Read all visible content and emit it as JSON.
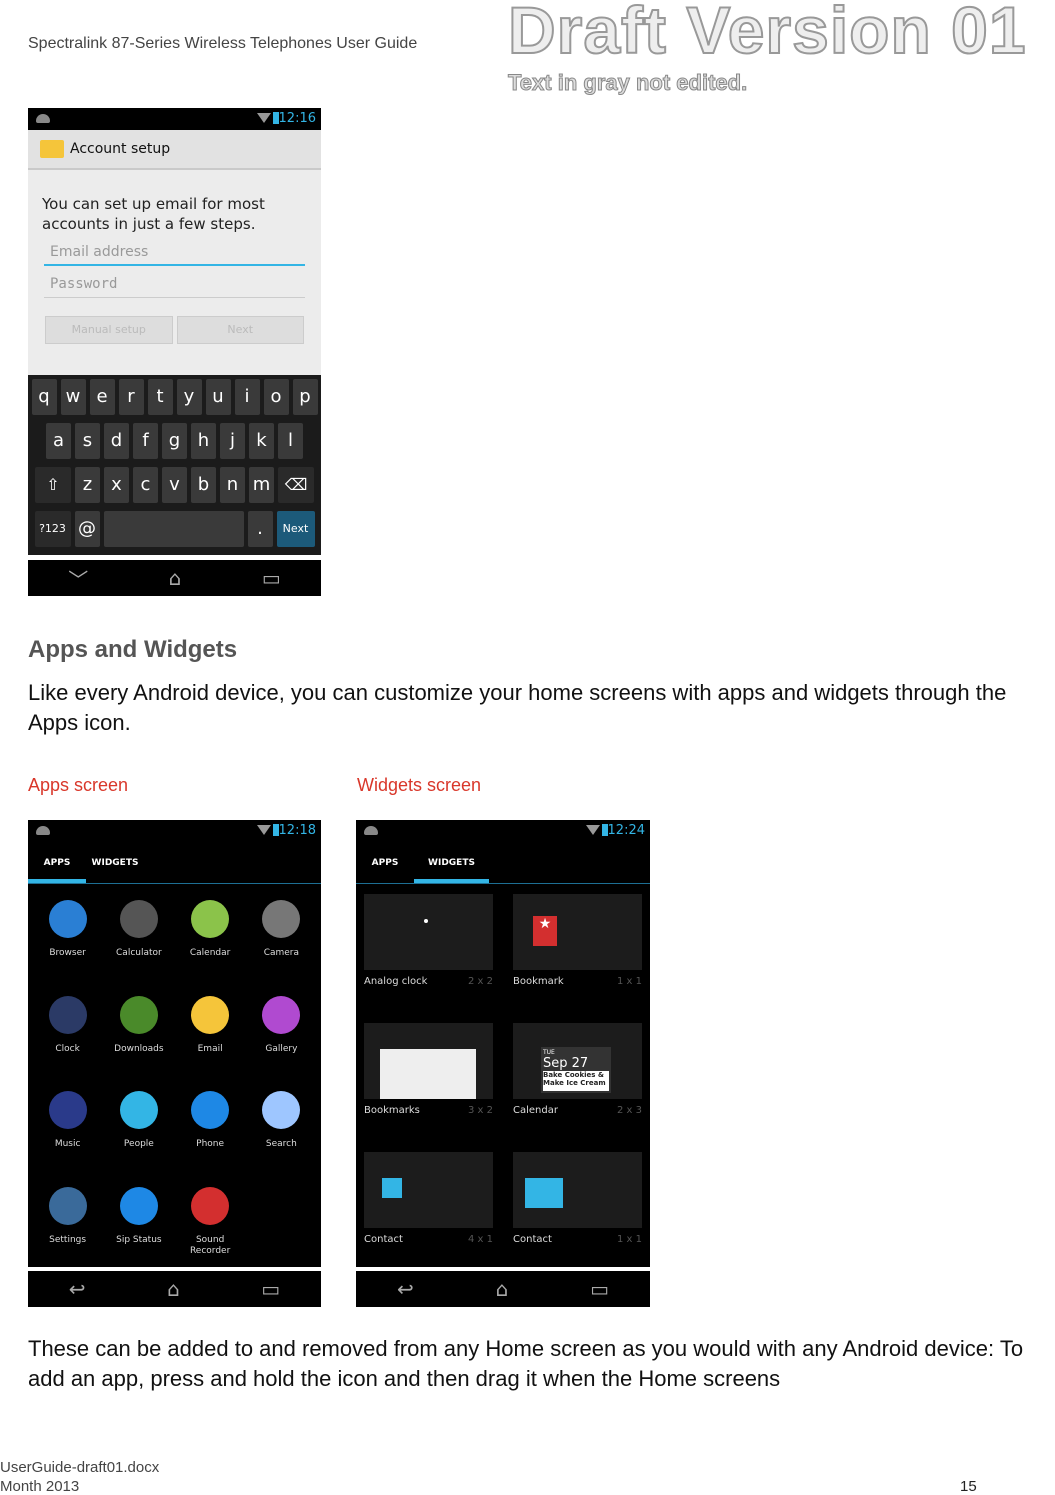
{
  "header": {
    "title": "Spectralink 87-Series Wireless Telephones User Guide",
    "watermark": "Draft Version 01",
    "watermark_note": "Text in gray not edited."
  },
  "screen1": {
    "time": "12:16",
    "title": "Account setup",
    "message": "You can set up email for most accounts in just a few steps.",
    "email_placeholder": "Email address",
    "password_placeholder": "Password",
    "manual_setup": "Manual setup",
    "next": "Next",
    "keyboard": {
      "row1": [
        "q",
        "w",
        "e",
        "r",
        "t",
        "y",
        "u",
        "i",
        "o",
        "p"
      ],
      "row2": [
        "a",
        "s",
        "d",
        "f",
        "g",
        "h",
        "j",
        "k",
        "l"
      ],
      "row3": [
        "⇧",
        "z",
        "x",
        "c",
        "v",
        "b",
        "n",
        "m",
        "⌫"
      ],
      "row4": [
        "?123",
        "@",
        "",
        ".",
        "Next"
      ]
    }
  },
  "section": {
    "heading": "Apps and Widgets",
    "intro": "Like every Android device, you can customize your home screens with apps and widgets through the Apps icon.",
    "apps_label": "Apps screen",
    "widgets_label": "Widgets screen",
    "outro": "These can be added to and removed from any Home screen as you would with any Android device: To add an app, press and hold the icon and then drag it when the Home screens"
  },
  "apps_screen": {
    "time": "12:18",
    "tabs": [
      "APPS",
      "WIDGETS"
    ],
    "apps": [
      {
        "label": "Browser",
        "color": "#2a7fd4"
      },
      {
        "label": "Calculator",
        "color": "#555"
      },
      {
        "label": "Calendar",
        "color": "#8bc34a"
      },
      {
        "label": "Camera",
        "color": "#777"
      },
      {
        "label": "Clock",
        "color": "#2b3a66"
      },
      {
        "label": "Downloads",
        "color": "#4a8a2a"
      },
      {
        "label": "Email",
        "color": "#f5c53a"
      },
      {
        "label": "Gallery",
        "color": "#b04ad0"
      },
      {
        "label": "Music",
        "color": "#2a3a8a"
      },
      {
        "label": "People",
        "color": "#33b5e5"
      },
      {
        "label": "Phone",
        "color": "#1e88e5"
      },
      {
        "label": "Search",
        "color": "#9ec6ff"
      },
      {
        "label": "Settings",
        "color": "#3a6a9a"
      },
      {
        "label": "Sip Status",
        "color": "#1e88e5"
      },
      {
        "label": "Sound Recorder",
        "color": "#d32f2f"
      }
    ]
  },
  "widgets_screen": {
    "time": "12:24",
    "tabs": [
      "APPS",
      "WIDGETS"
    ],
    "widgets": [
      {
        "label": "Analog clock",
        "size": "2 x 2"
      },
      {
        "label": "Bookmark",
        "size": "1 x 1"
      },
      {
        "label": "Bookmarks",
        "size": "3 x 2"
      },
      {
        "label": "Calendar",
        "size": "2 x 3"
      },
      {
        "label": "Contact",
        "size": "4 x 1"
      },
      {
        "label": "Contact",
        "size": "1 x 1"
      }
    ],
    "calendar_preview": {
      "day": "TUE",
      "date": "Sep 27",
      "event": "Bake Cookies & Make Ice Cream"
    }
  },
  "footer": {
    "file": "UserGuide-draft01.docx",
    "date": "Month 2013",
    "page": "15"
  }
}
